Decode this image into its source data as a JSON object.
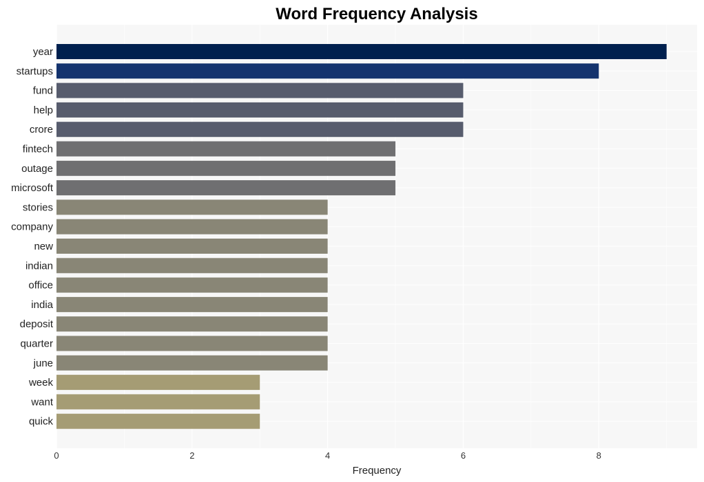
{
  "chart_data": {
    "type": "bar",
    "orientation": "horizontal",
    "title": "Word Frequency Analysis",
    "xlabel": "Frequency",
    "ylabel": "",
    "xlim": [
      0,
      9.45
    ],
    "xticks": [
      0,
      2,
      4,
      6,
      8
    ],
    "grid": true,
    "legend": "none",
    "categories": [
      "year",
      "startups",
      "fund",
      "help",
      "crore",
      "fintech",
      "outage",
      "microsoft",
      "stories",
      "company",
      "new",
      "indian",
      "office",
      "india",
      "deposit",
      "quarter",
      "june",
      "week",
      "want",
      "quick"
    ],
    "values": [
      9,
      8,
      6,
      6,
      6,
      5,
      5,
      5,
      4,
      4,
      4,
      4,
      4,
      4,
      4,
      4,
      4,
      3,
      3,
      3
    ],
    "colors": [
      "#00204e",
      "#14336e",
      "#575c6d",
      "#575c6d",
      "#575c6d",
      "#6f6f71",
      "#6f6f71",
      "#6f6f71",
      "#898676",
      "#898676",
      "#898676",
      "#898676",
      "#898676",
      "#898676",
      "#898676",
      "#898676",
      "#898676",
      "#a59c74",
      "#a59c74",
      "#a59c74"
    ],
    "plot_background": "#f7f7f7",
    "grid_color": "#ffffff"
  }
}
